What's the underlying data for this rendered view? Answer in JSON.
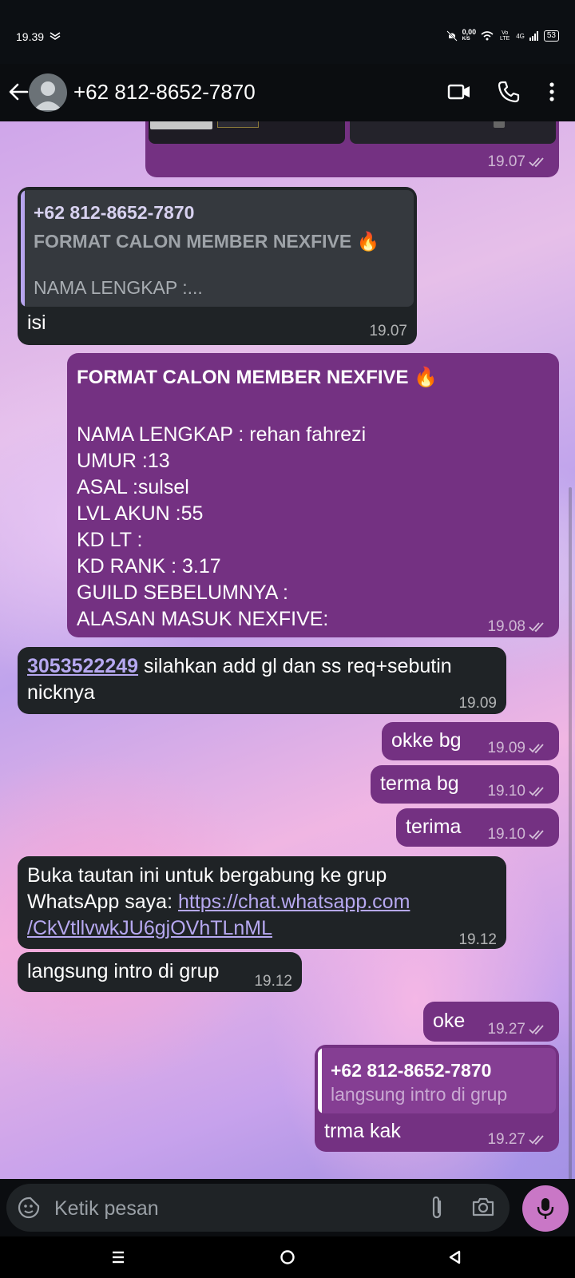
{
  "status_bar": {
    "time": "19.39",
    "network_speed": "0,00",
    "network_unit": "K/S",
    "volte": "Vo LTE",
    "signal_type": "4G",
    "battery": "53"
  },
  "header": {
    "contact_name": "+62 812-8652-7870",
    "icons": [
      "back-arrow-icon",
      "avatar",
      "video-call-icon",
      "voice-call-icon",
      "more-options-icon"
    ]
  },
  "messages": [
    {
      "dir": "out",
      "type": "image-partial",
      "time": "19.07",
      "ticks": true
    },
    {
      "dir": "in",
      "quote_name": "+62 812-8652-7870",
      "quote_line1": "FORMAT CALON MEMBER NEXFIVE 🔥",
      "quote_line2": "NAMA LENGKAP :...",
      "text": "isi",
      "time": "19.07"
    },
    {
      "dir": "out",
      "title": "FORMAT CALON MEMBER NEXFIVE 🔥",
      "lines": [
        "NAMA LENGKAP : rehan fahrezi",
        "UMUR :13",
        "ASAL :sulsel",
        "LVL AKUN :55",
        "KD LT :",
        "KD RANK : 3.17",
        "GUILD SEBELUMNYA :",
        "ALASAN MASUK NEXFIVE:"
      ],
      "time": "19.08",
      "ticks": true
    },
    {
      "dir": "in",
      "link": "3053522249",
      "text_after": " silahkan add gl dan ss req+sebutin",
      "text_line2": "nicknya",
      "time": "19.09"
    },
    {
      "dir": "out",
      "text": "okke bg",
      "time": "19.09",
      "ticks": true
    },
    {
      "dir": "out",
      "text": "terma bg",
      "time": "19.10",
      "ticks": true
    },
    {
      "dir": "out",
      "text": "terima",
      "time": "19.10",
      "ticks": true
    },
    {
      "dir": "in",
      "line1": "Buka tautan ini untuk bergabung ke grup",
      "line2_text": "WhatsApp saya: ",
      "line2_link": "https://chat.whatsapp.com",
      "line3_link": "/CkVtllvwkJU6gjOVhTLnML",
      "time": "19.12"
    },
    {
      "dir": "in",
      "text": "langsung intro di grup",
      "time": "19.12"
    },
    {
      "dir": "out",
      "text": "oke",
      "time": "19.27",
      "ticks": true
    },
    {
      "dir": "out",
      "quote_name": "+62 812-8652-7870",
      "quote_text": "langsung intro di grup",
      "text": "trma kak",
      "time": "19.27",
      "ticks": true
    }
  ],
  "input": {
    "placeholder": "Ketik pesan",
    "icons": [
      "sticker-icon",
      "attach-icon",
      "camera-icon",
      "mic-icon"
    ]
  },
  "nav": [
    "recents-icon",
    "home-icon",
    "back-icon"
  ],
  "colors": {
    "incoming_bubble": "#1f2326",
    "outgoing_bubble": "#743182",
    "mic_button": "#c977c6",
    "link": "#b6a8f0"
  }
}
